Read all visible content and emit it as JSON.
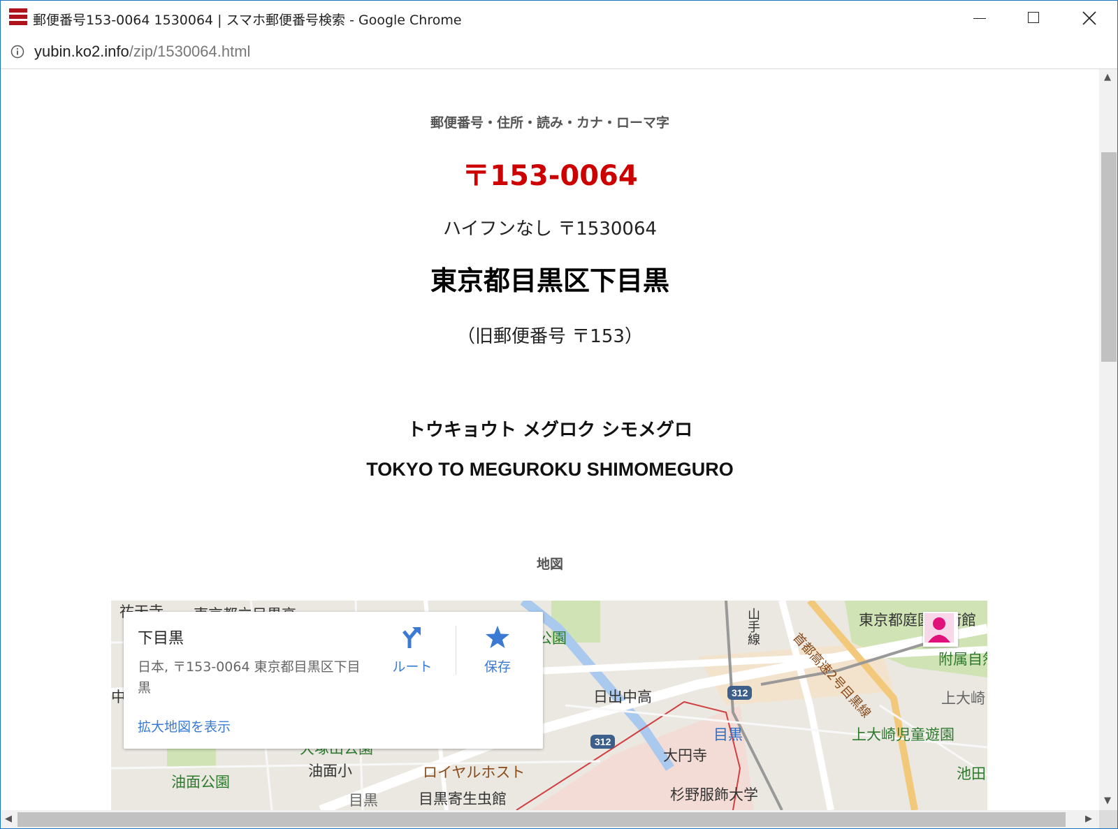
{
  "window": {
    "title": "郵便番号153-0064 1530064 | スマホ郵便番号検索 - Google Chrome"
  },
  "address_bar": {
    "domain": "yubin.ko2.info",
    "path": "/zip/1530064.html"
  },
  "page": {
    "heading": "郵便番号・住所・読み・カナ・ローマ字",
    "zip": "〒153-0064",
    "zip_nohyphen": "ハイフンなし 〒1530064",
    "address": "東京都目黒区下目黒",
    "old_zip": "（旧郵便番号 〒153）",
    "kana": "トウキョウト メグロク シモメグロ",
    "romaji": "TOKYO TO MEGUROKU SHIMOMEGURO",
    "map_heading": "地図"
  },
  "map": {
    "card": {
      "place": "下目黒",
      "address": "日本, 〒153-0064 東京都目黒区下目黒",
      "route_label": "ルート",
      "save_label": "保存",
      "larger_map_link": "拡大地図を表示"
    },
    "labels": {
      "hiraten": "祐天寺",
      "meguro_high": "東京都立目黒高",
      "naka": "中",
      "park_top": "公園",
      "hinode": "日出中高",
      "yamanote": "山手線",
      "shuto": "首都高速2号目黒線",
      "teien": "東京都庭園美術館",
      "fuzoku": "附属自然",
      "kamiosaki": "上大崎",
      "meguro_station": "目黒",
      "kamiosaki_park": "上大崎児童遊園",
      "daienji": "大円寺",
      "otsukayama": "大塚山公園",
      "aburamen_park": "油面公園",
      "aburamen_school": "油面小",
      "royal_host": "ロイヤルホスト",
      "ikeda": "池田",
      "kiseichu": "目黒寄生虫館",
      "sugino": "杉野服飾大学",
      "meguro_bottom": "目黒",
      "route_312a": "312",
      "route_312b": "312"
    }
  }
}
